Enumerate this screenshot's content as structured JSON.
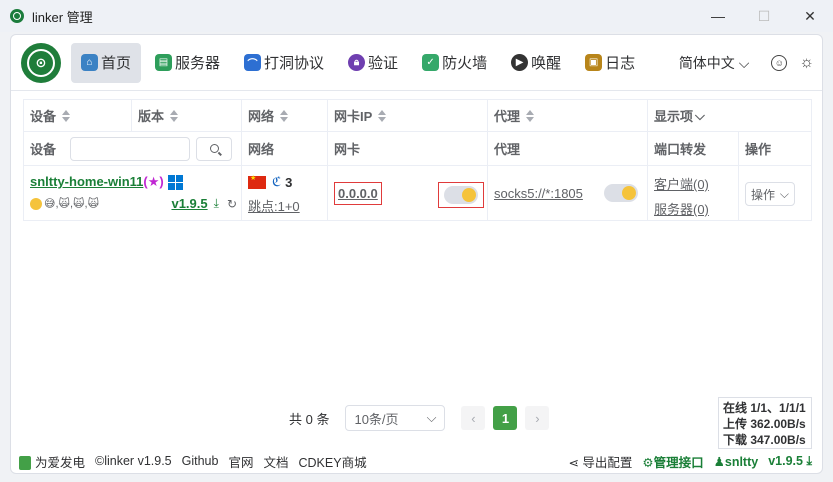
{
  "window": {
    "title": "linker 管理"
  },
  "nav": {
    "logo": "⊙",
    "items": [
      {
        "label": "首页",
        "icon": "home-icon",
        "color": "#3b82c4"
      },
      {
        "label": "服务器",
        "icon": "server-icon",
        "color": "#2e9e5b"
      },
      {
        "label": "打洞协议",
        "icon": "tunnel-icon",
        "color": "#2d6fd2"
      },
      {
        "label": "验证",
        "icon": "lock-icon",
        "color": "#6f3fb0"
      },
      {
        "label": "防火墙",
        "icon": "shield-icon",
        "color": "#35a86a"
      },
      {
        "label": "唤醒",
        "icon": "play-icon",
        "color": "#333333"
      },
      {
        "label": "日志",
        "icon": "log-icon",
        "color": "#b8851a"
      }
    ],
    "language": "简体中文"
  },
  "table": {
    "headers": [
      "设备",
      "版本",
      "网络",
      "网卡IP",
      "代理",
      "显示项"
    ],
    "subheaders": [
      "设备",
      "网络",
      "网卡",
      "代理",
      "端口转发",
      "操作"
    ],
    "row": {
      "device": "snltty-home-win11",
      "star": "(★)",
      "emojis": "😅,🙀,🙀,🙀",
      "version": "v1.9.5",
      "network_count": "3",
      "hops": "跳点:1+0",
      "nic_ip": "0.0.0.0",
      "proxy": "socks5://*:1805",
      "client": "客户端(0)",
      "server": "服务器(0)",
      "operation": "操作"
    }
  },
  "pagination": {
    "total": "共 0 条",
    "page_size": "10条/页",
    "current": "1"
  },
  "stats": {
    "online": "在线 1/1、1/1/1",
    "upload": "上传 362.00B/s",
    "download": "下载 347.00B/s"
  },
  "footer": {
    "left": [
      "为爱发电",
      "©linker v1.9.5",
      "Github",
      "官网",
      "文档",
      "CDKEY商城"
    ],
    "export": "导出配置",
    "manage": "管理接口",
    "user": "snltty",
    "version": "v1.9.5"
  },
  "colors": {
    "accent": "#1a7f37",
    "page_active": "#43a047",
    "highlight_border": "#e03b3b"
  }
}
